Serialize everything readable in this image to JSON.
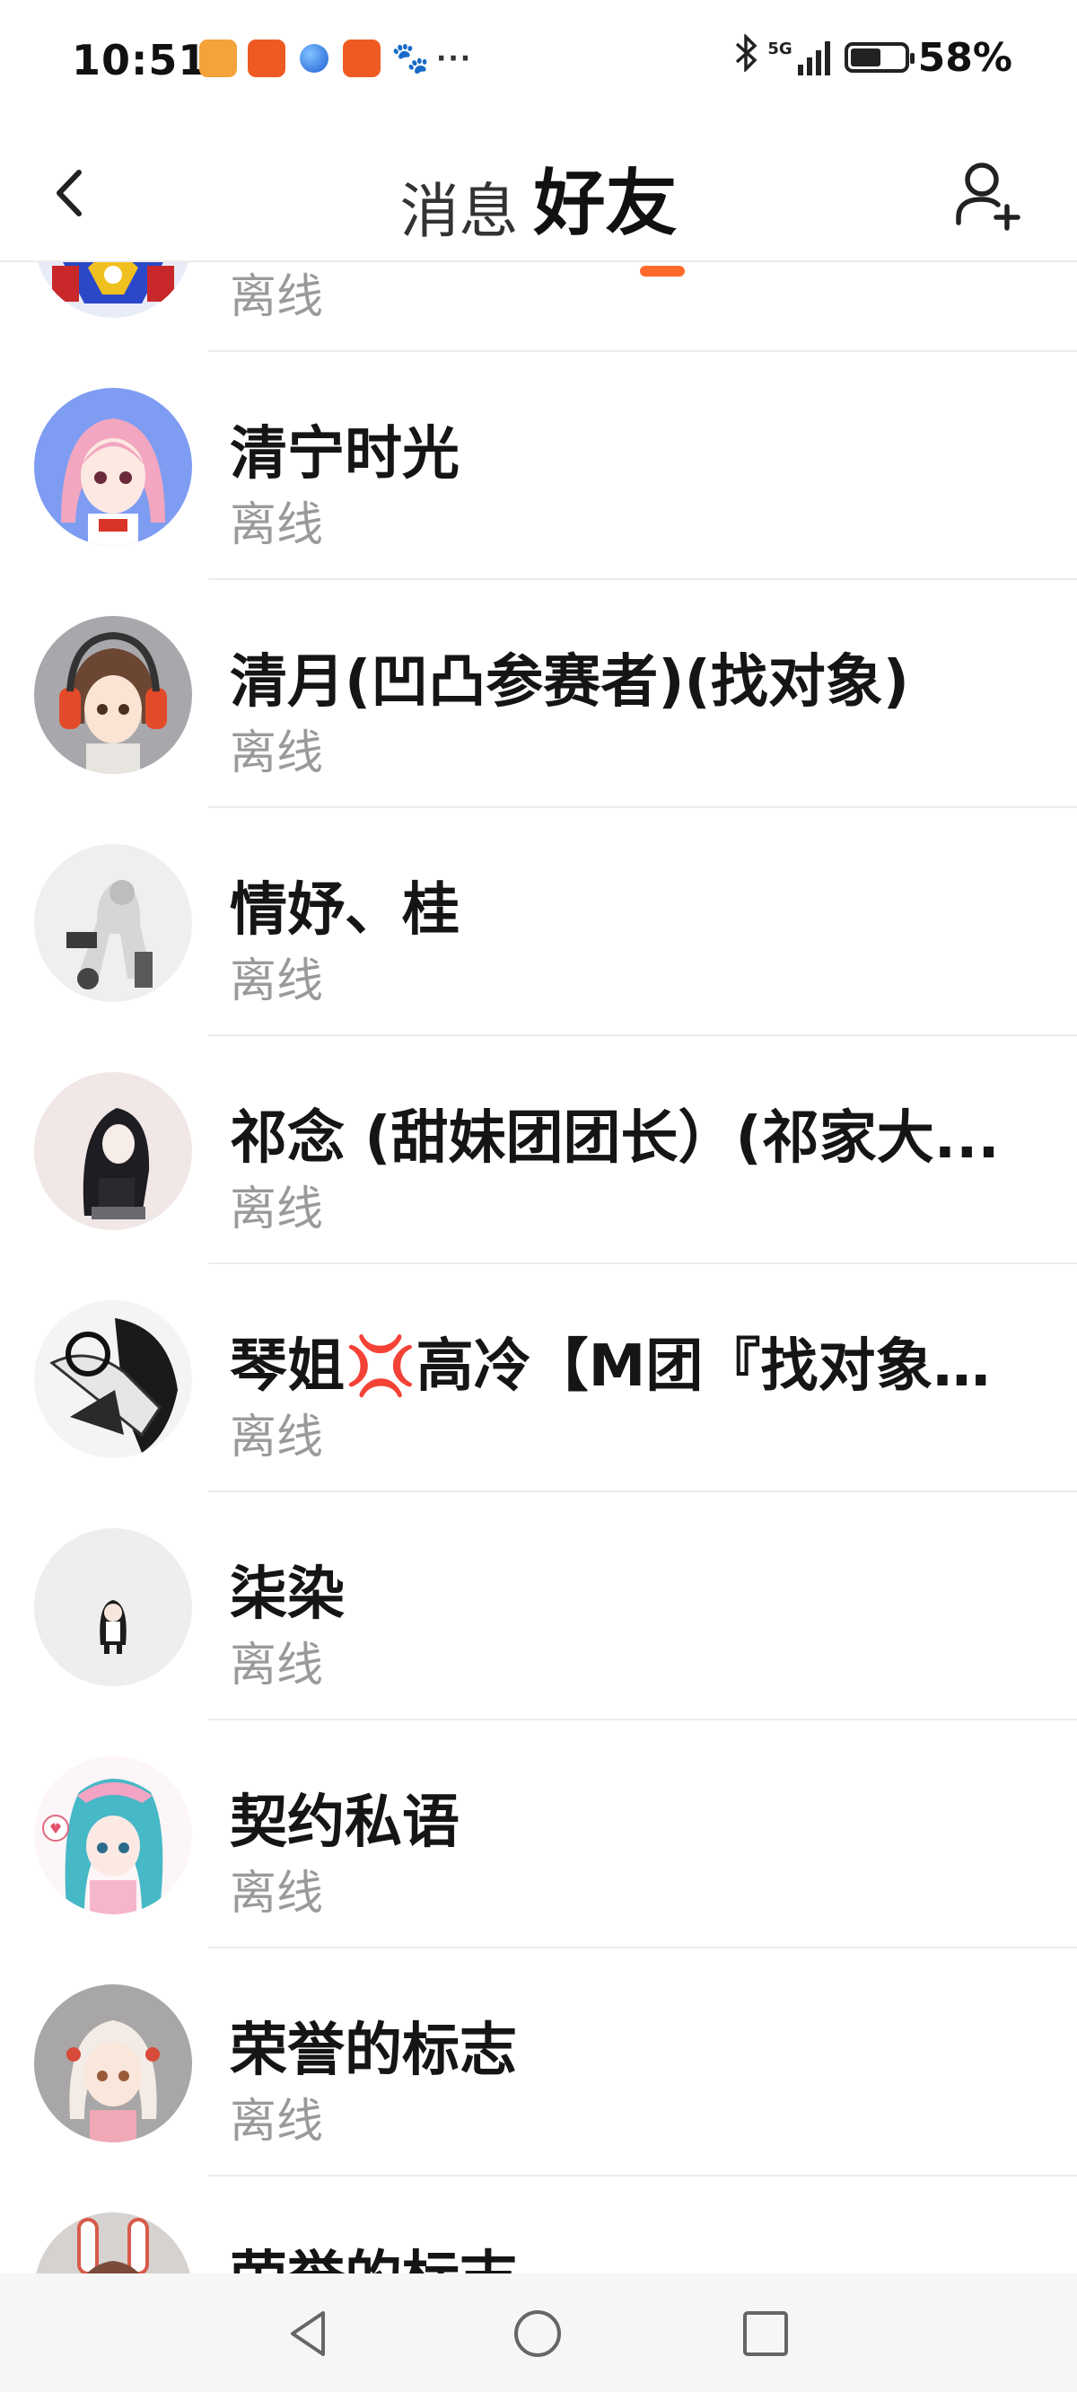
{
  "status_bar": {
    "time": "10:51",
    "network": "5G",
    "battery_percent": "58%",
    "battery_level": 0.58,
    "notification_icons": [
      "heart-app-icon",
      "kuaishou-icon",
      "browser-ball-icon",
      "kuaishou-icon",
      "baidu-paw-icon",
      "more-dots-icon"
    ]
  },
  "header": {
    "tab_messages": "消息",
    "tab_friends": "好友",
    "active_tab": "好友",
    "accent_color": "#ff6a2c"
  },
  "friends": [
    {
      "name": "",
      "status": "离线",
      "avatar": "robot-avatar"
    },
    {
      "name": "清宁时光",
      "status": "离线",
      "avatar": "pink-hair-girl-avatar"
    },
    {
      "name": "清月(凹凸参赛者)(找对象)",
      "status": "离线",
      "avatar": "headphones-girl-avatar"
    },
    {
      "name": "情妤、桂",
      "status": "离线",
      "avatar": "mecha-figure-avatar"
    },
    {
      "name": "祁念 (甜妹团团长）(祁家大...",
      "status": "离线",
      "avatar": "dark-hair-girl-avatar"
    },
    {
      "name": "琴姐💢高冷【M团『找对象』...",
      "status": "离线",
      "avatar": "monochrome-figure-avatar"
    },
    {
      "name": "柒染",
      "status": "离线",
      "avatar": "small-doll-avatar"
    },
    {
      "name": "契约私语",
      "status": "离线",
      "avatar": "teal-hair-girl-avatar"
    },
    {
      "name": "荣誉的标志",
      "status": "离线",
      "avatar": "white-hair-girl-avatar"
    },
    {
      "name": "荣誉的标志",
      "status": "",
      "avatar": "bunny-ears-avatar"
    }
  ],
  "nav_bar": {
    "back": "triangle-back-icon",
    "home": "circle-home-icon",
    "recents": "square-recents-icon"
  }
}
